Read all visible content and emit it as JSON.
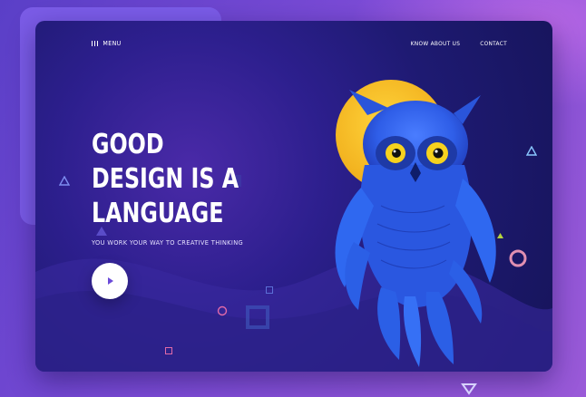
{
  "nav": {
    "menu_label": "MENU",
    "links": [
      {
        "label": "KNOW ABOUT US"
      },
      {
        "label": "CONTACT"
      }
    ]
  },
  "hero": {
    "headline_lines": [
      "GOOD",
      "DESIGN IS A",
      "LANGUAGE"
    ],
    "subtitle": "YOU WORK YOUR WAY TO CREATIVE THINKING"
  },
  "illustration": {
    "subject": "owl",
    "moon_color": "#f2b21f",
    "owl_color": "#2f6cff"
  },
  "colors": {
    "background": "#6a44d0",
    "frame": "#1e1a72",
    "accent_yellow": "#ffd43b",
    "text": "#ffffff"
  }
}
